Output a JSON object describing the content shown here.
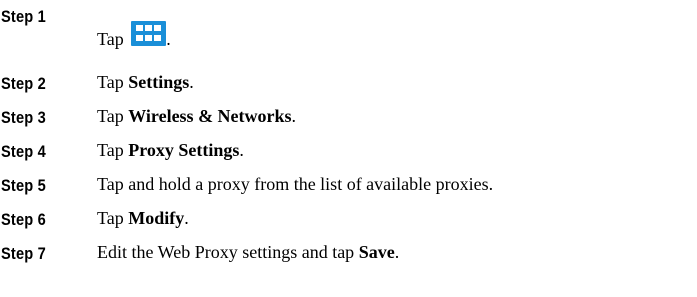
{
  "steps": [
    {
      "label": "Step 1",
      "text": "Tap ",
      "after": ".",
      "icon": "apps-grid-icon",
      "icon_color": "#1a8fd8"
    },
    {
      "label": "Step 2",
      "text": "Tap ",
      "bold": "Settings",
      "after": "."
    },
    {
      "label": "Step 3",
      "text": "Tap ",
      "bold": "Wireless & Networks",
      "after": "."
    },
    {
      "label": "Step 4",
      "text": "Tap ",
      "bold": "Proxy Settings",
      "after": "."
    },
    {
      "label": "Step 5",
      "text": "Tap and hold a proxy from the list of available proxies."
    },
    {
      "label": "Step 6",
      "text": "Tap ",
      "bold": "Modify",
      "after": "."
    },
    {
      "label": "Step 7",
      "text": "Edit the Web Proxy settings and tap ",
      "bold": "Save",
      "after": "."
    }
  ]
}
